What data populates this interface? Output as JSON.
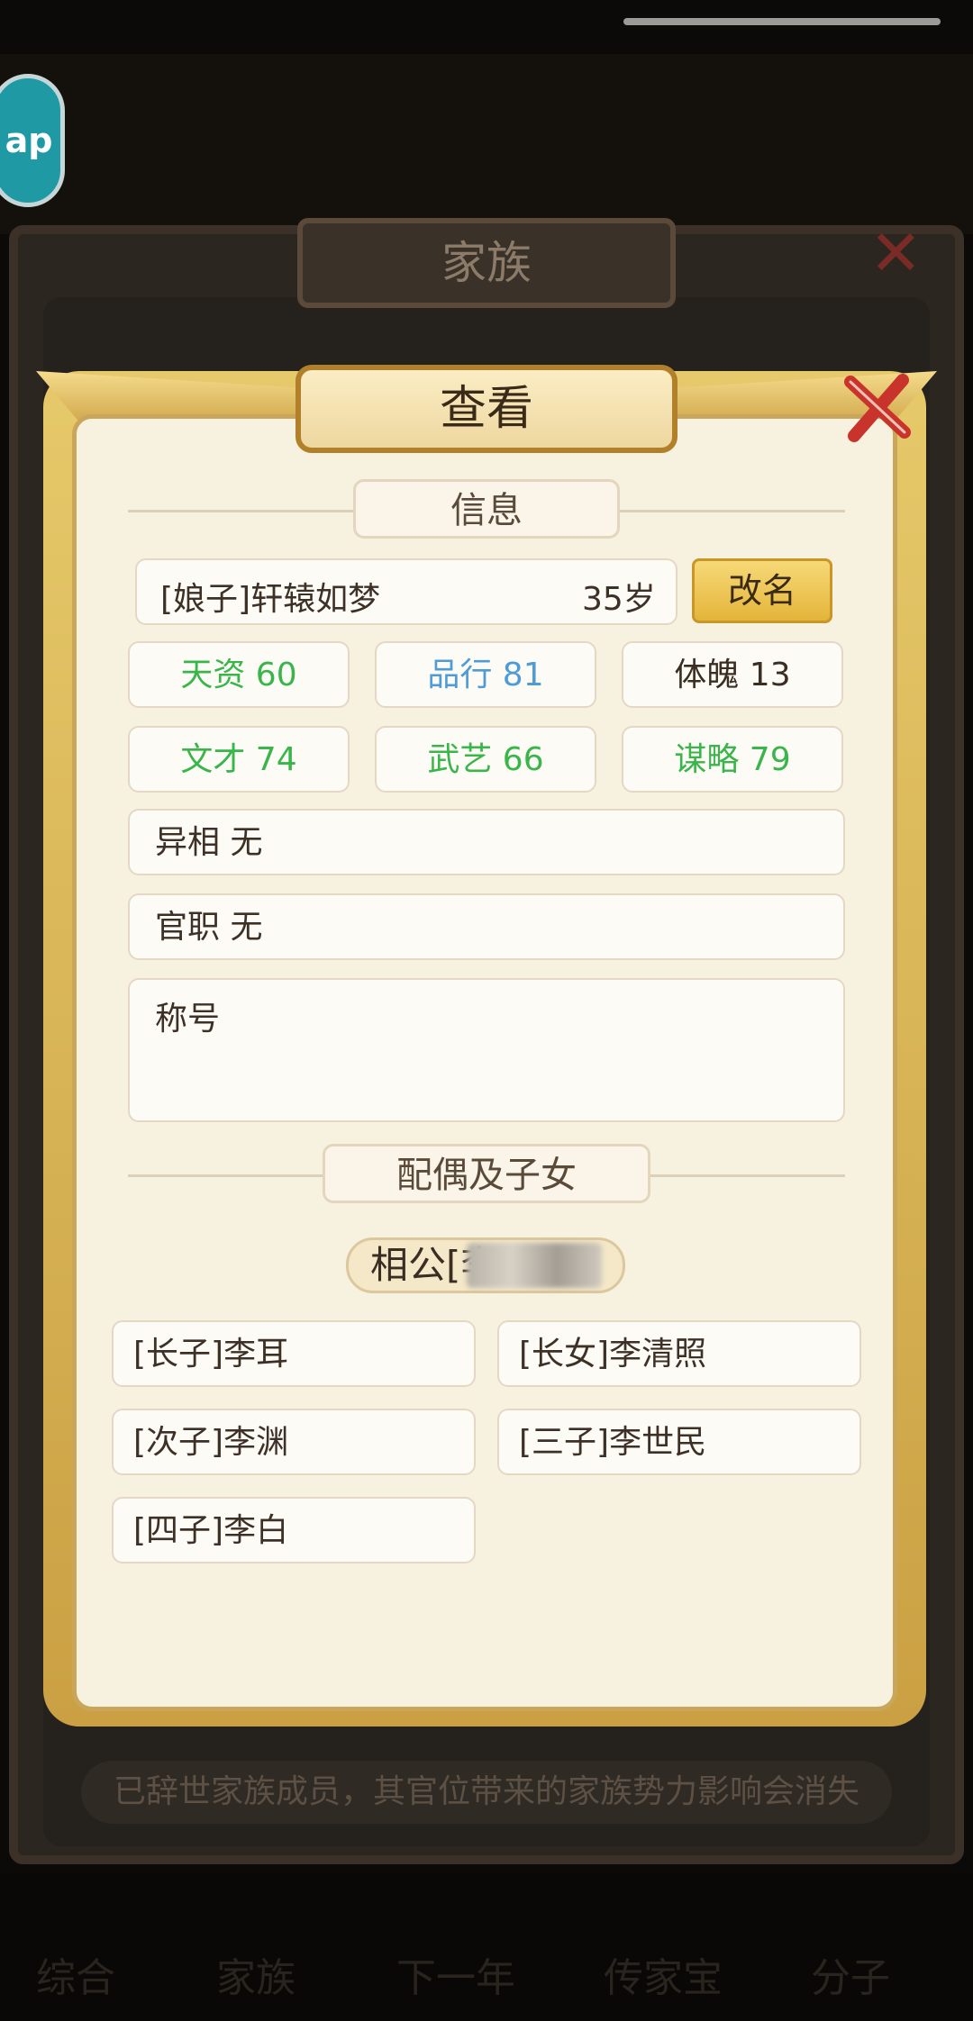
{
  "background": {
    "side_badge": "ap",
    "back_panel_title": "家族",
    "footer_notice": "已辞世家族成员，其官位带来的家族势力影响会消失",
    "bottom_nav": [
      "综合",
      "家族",
      "下一年",
      "传家宝",
      "分子"
    ]
  },
  "dialog": {
    "title": "查看",
    "info_section": "信息",
    "member": {
      "name": "[娘子]轩辕如梦",
      "age": "35岁",
      "rename_button": "改名"
    },
    "stats": [
      {
        "label": "天资 60",
        "color": "green"
      },
      {
        "label": "品行 81",
        "color": "blue"
      },
      {
        "label": "体魄 13",
        "color": "dark"
      },
      {
        "label": "文才 74",
        "color": "green"
      },
      {
        "label": "武艺 66",
        "color": "green"
      },
      {
        "label": "谋略 79",
        "color": "green"
      }
    ],
    "trait": "异相 无",
    "office": "官职 无",
    "title_field": "称号",
    "family_section": "配偶及子女",
    "spouse": "相公[李",
    "children": [
      "[长子]李耳",
      "[长女]李清照",
      "[次子]李渊",
      "[三子]李世民",
      "[四子]李白"
    ]
  },
  "colors": {
    "green": "#3ab54a",
    "blue": "#4f9bd6",
    "gold": "#e4b43a"
  }
}
